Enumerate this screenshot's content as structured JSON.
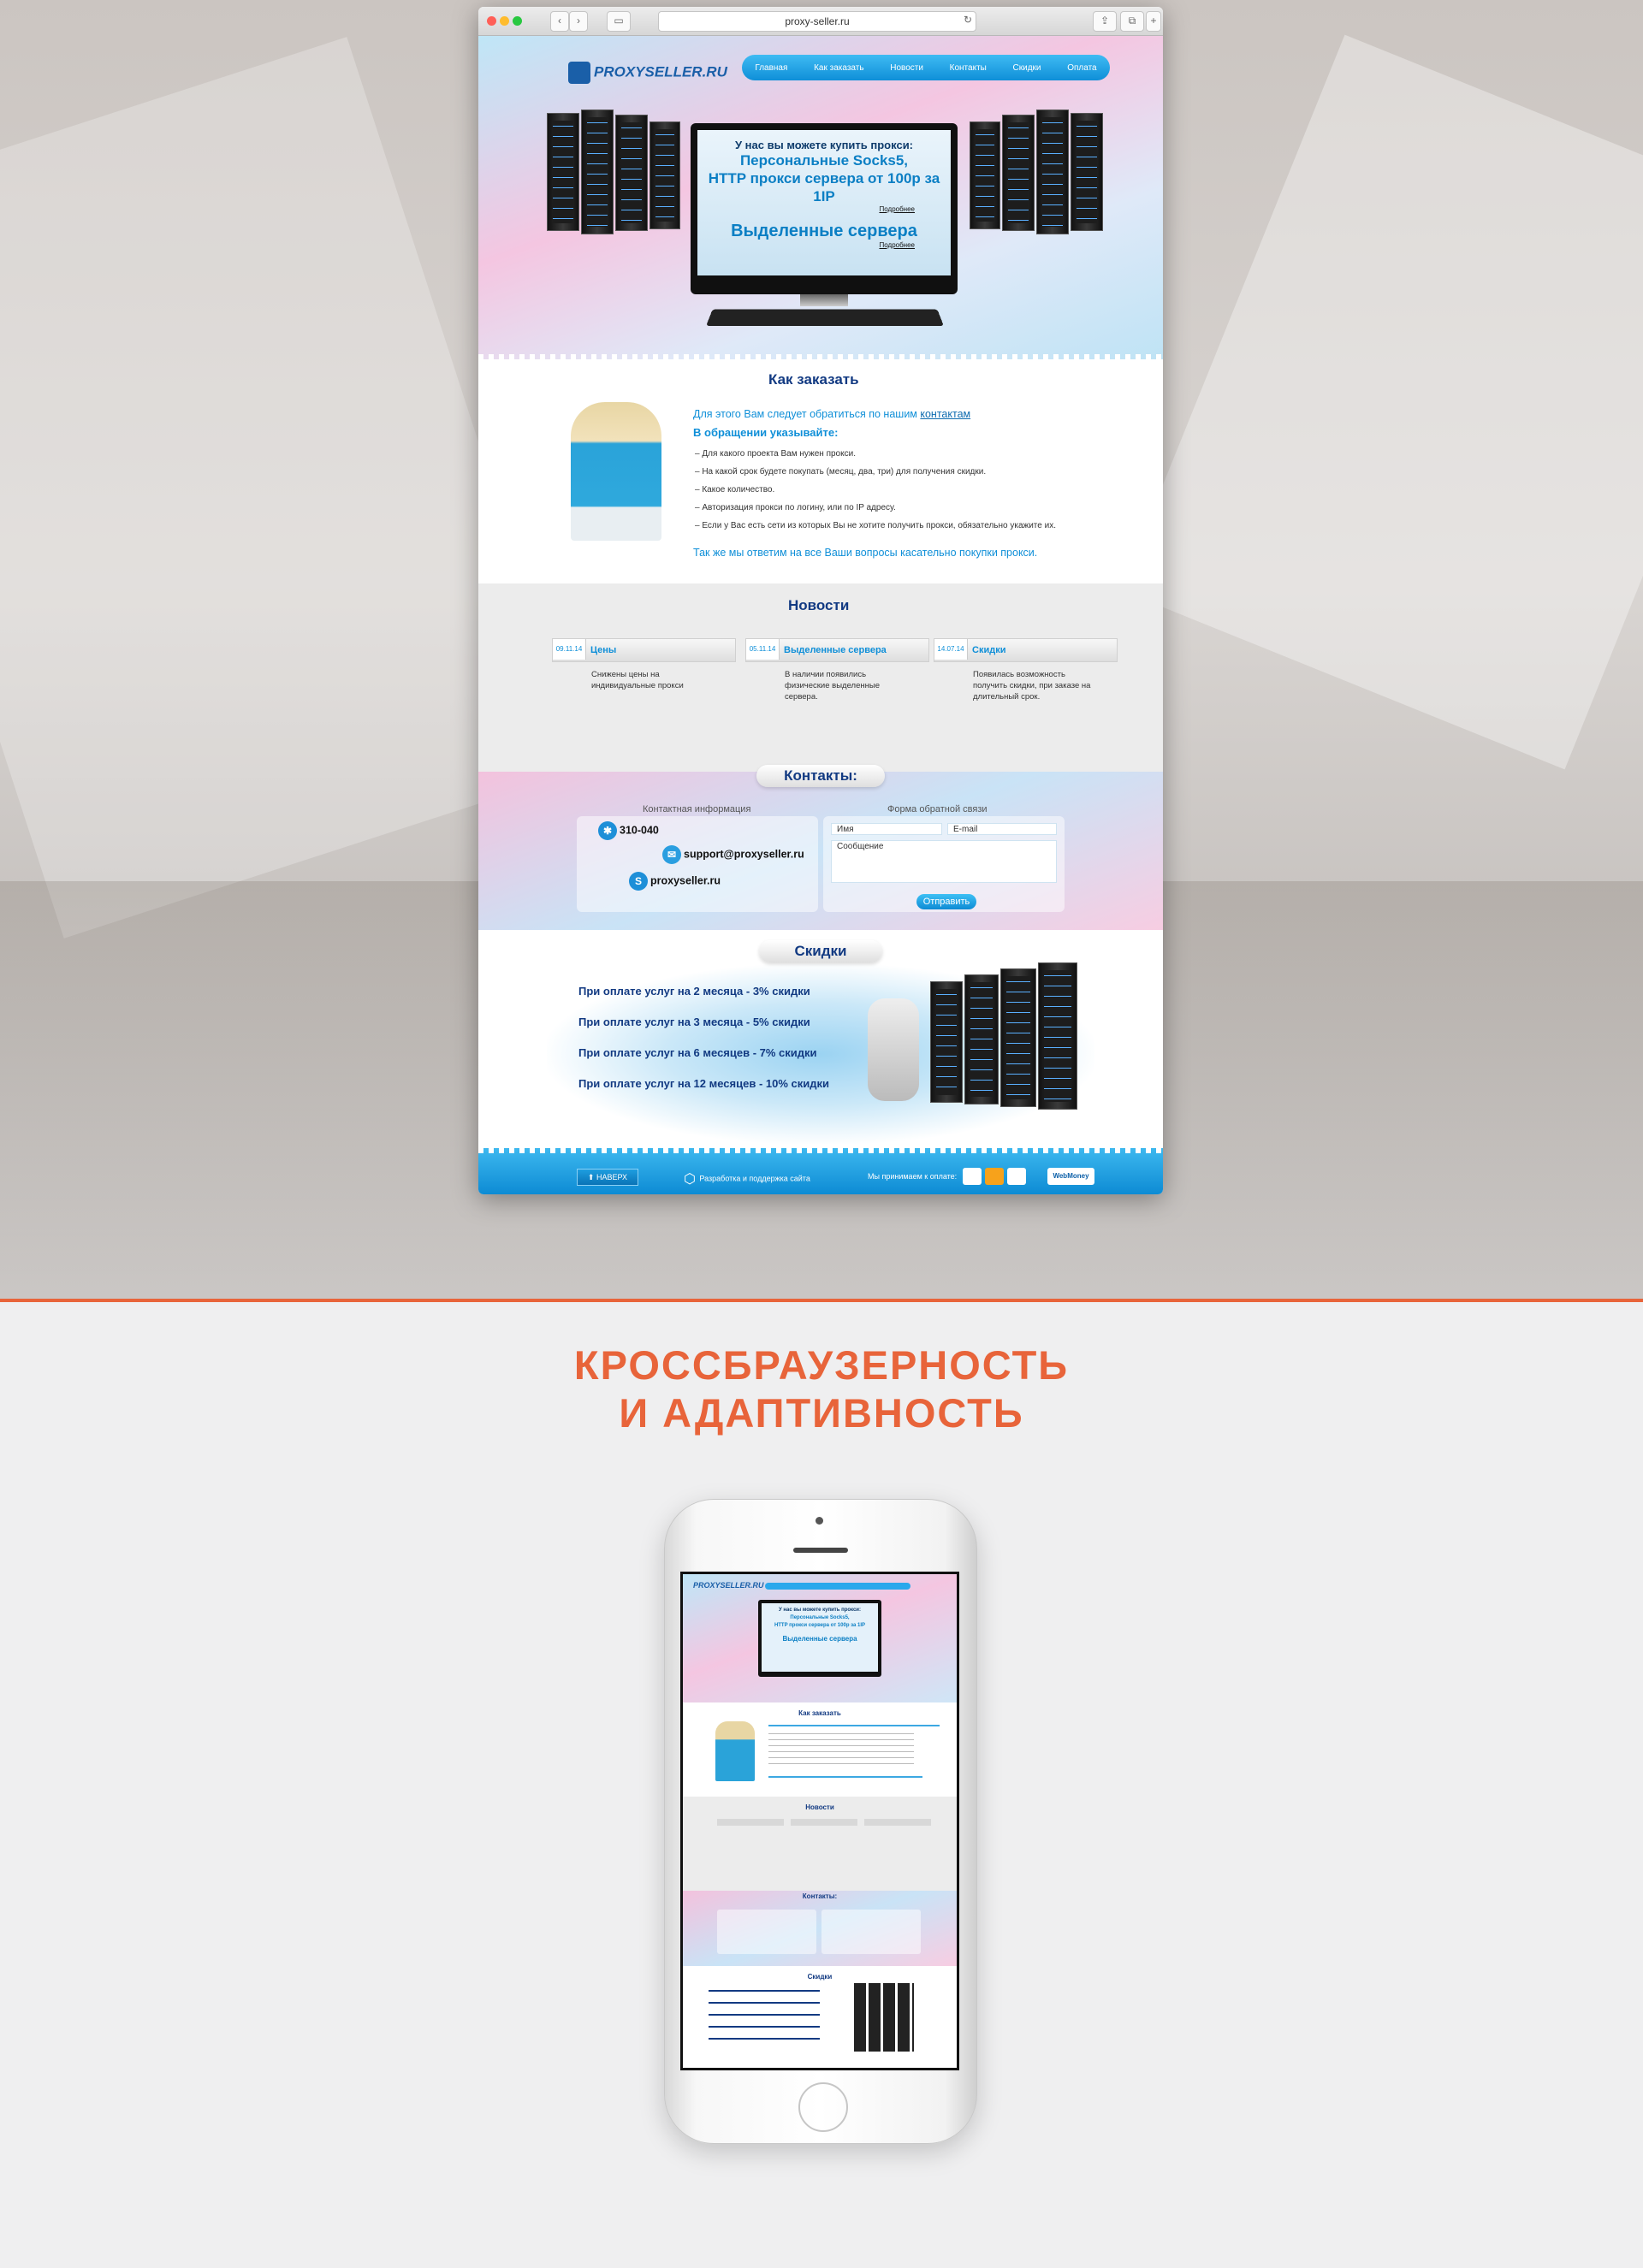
{
  "browser": {
    "url": "proxy-seller.ru",
    "back_icon": "chevron-left-icon",
    "forward_icon": "chevron-right-icon"
  },
  "site": {
    "logo": "PROXYSELLER.RU",
    "nav": [
      "Главная",
      "Как заказать",
      "Новости",
      "Контакты",
      "Скидки",
      "Оплата"
    ],
    "hero": {
      "line1": "У нас вы можете купить прокси:",
      "line2": "Персональные Socks5,",
      "line3": "HTTP прокси сервера от 100р за 1IP",
      "more1": "Подробнее",
      "line4": "Выделенные сервера",
      "more2": "Подробнее"
    },
    "order": {
      "title": "Как заказать",
      "lead_text": "Для этого Вам следует обратиться по нашим ",
      "lead_link": "контактам",
      "subtitle": "В обращении указывайте:",
      "items": [
        "– Для какого проекта Вам нужен прокси.",
        "– На какой срок будете покупать (месяц, два, три) для получения скидки.",
        "– Какое количество.",
        "– Авторизация прокси по логину, или по IP адресу.",
        "– Если у Вас есть сети из которых Вы не хотите получить прокси, обязательно укажите их."
      ],
      "footer": "Так же мы ответим на все Ваши вопросы касательно покупки прокси."
    },
    "news": {
      "title": "Новости",
      "items": [
        {
          "date": "09.11.14",
          "title": "Цены",
          "text": "Снижены цены на индивидуальные прокси"
        },
        {
          "date": "05.11.14",
          "title": "Выделенные сервера",
          "text": "В наличии появились физические выделенные сервера."
        },
        {
          "date": "14.07.14",
          "title": "Скидки",
          "text": "Появилась возможность получить скидки, при заказе на длительный срок."
        }
      ]
    },
    "contacts": {
      "title": "Контакты:",
      "info_label": "Контактная информация",
      "form_label": "Форма обратной связи",
      "icq": "310-040",
      "email": "support@proxyseller.ru",
      "skype": "proxyseller.ru",
      "name_placeholder": "Имя",
      "email_placeholder": "E-mail",
      "message_placeholder": "Сообщение",
      "send": "Отправить"
    },
    "discounts": {
      "title": "Скидки",
      "items": [
        "При оплате услуг на 2 месяца - 3% скидки",
        "При оплате услуг на 3 месяца - 5% скидки",
        "При оплате услуг на 6 месяцев - 7% скидки",
        "При оплате услуг на 12 месяцев - 10% скидки"
      ]
    },
    "footer": {
      "top": "НАВЕРХ",
      "dev": "Разработка и поддержка сайта",
      "pay": "Мы принимаем к оплате:",
      "webmoney": "WebMoney"
    }
  },
  "headline": {
    "line1": "Кроссбраузерность",
    "line2": "и адаптивность"
  },
  "colors": {
    "accent": "#e8643a",
    "brand_blue": "#0f8fd8",
    "dark_blue": "#123a82"
  }
}
